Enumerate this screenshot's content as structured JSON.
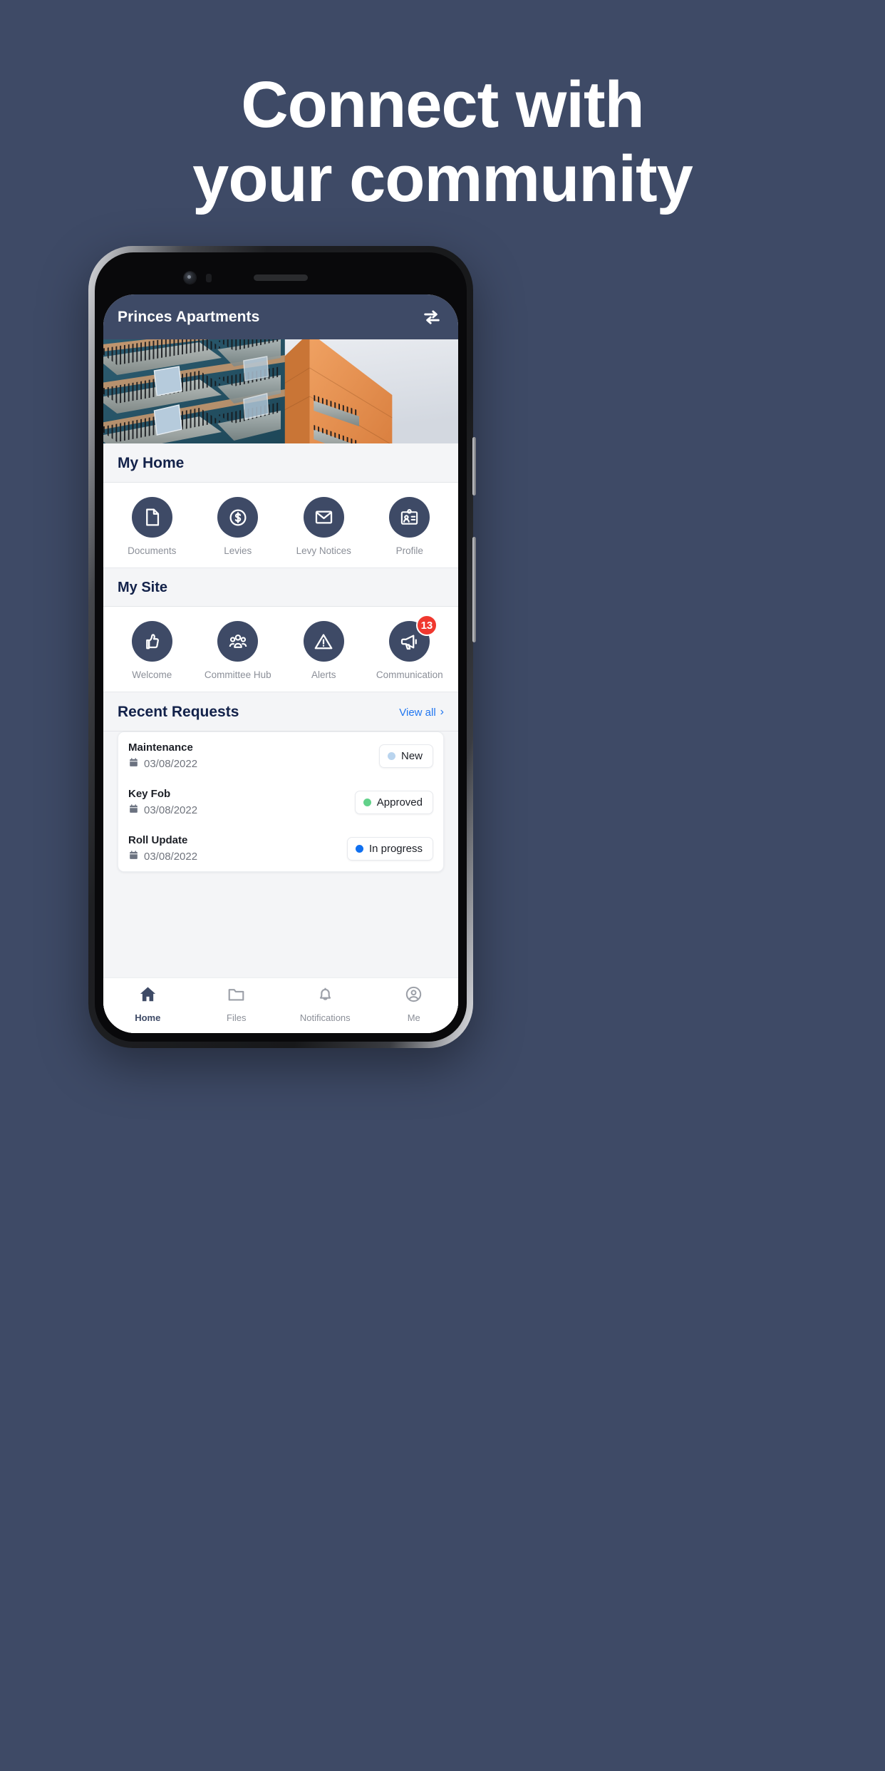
{
  "promo": {
    "heading_line1": "Connect with",
    "heading_line2": "your community",
    "background_color": "#3e4a66"
  },
  "app": {
    "header": {
      "title": "Princes Apartments",
      "switch_icon": "swap-arrows-icon",
      "background_color": "#3e4a66"
    },
    "hero": {
      "alt": "apartment-building-photo"
    },
    "sections": [
      {
        "title": "My Home",
        "tiles": [
          {
            "label": "Documents",
            "icon": "document-icon"
          },
          {
            "label": "Levies",
            "icon": "dollar-coin-icon"
          },
          {
            "label": "Levy Notices",
            "icon": "envelope-icon"
          },
          {
            "label": "Profile",
            "icon": "id-card-icon"
          }
        ]
      },
      {
        "title": "My Site",
        "tiles": [
          {
            "label": "Welcome",
            "icon": "thumbs-up-icon"
          },
          {
            "label": "Committee Hub",
            "icon": "people-group-icon"
          },
          {
            "label": "Alerts",
            "icon": "warning-triangle-icon"
          },
          {
            "label": "Communication",
            "icon": "megaphone-icon",
            "badge": "13"
          }
        ]
      }
    ],
    "recent_requests": {
      "title": "Recent Requests",
      "view_all_label": "View all",
      "view_all_chevron": "›",
      "items": [
        {
          "name": "Maintenance",
          "date": "03/08/2022",
          "status": "New",
          "status_color": "#b9d4ee"
        },
        {
          "name": "Key Fob",
          "date": "03/08/2022",
          "status": "Approved",
          "status_color": "#62d18a"
        },
        {
          "name": "Roll Update",
          "date": "03/08/2022",
          "status": "In progress",
          "status_color": "#1070f0"
        }
      ]
    },
    "bottom_nav": [
      {
        "label": "Home",
        "icon": "home-icon",
        "active": true
      },
      {
        "label": "Files",
        "icon": "folder-icon",
        "active": false
      },
      {
        "label": "Notifications",
        "icon": "bell-icon",
        "active": false
      },
      {
        "label": "Me",
        "icon": "person-circle-icon",
        "active": false
      }
    ]
  },
  "colors": {
    "brand_navy": "#3e4a66",
    "accent_blue": "#2076f0",
    "badge_red": "#f0382f",
    "heading_navy": "#13224a"
  }
}
